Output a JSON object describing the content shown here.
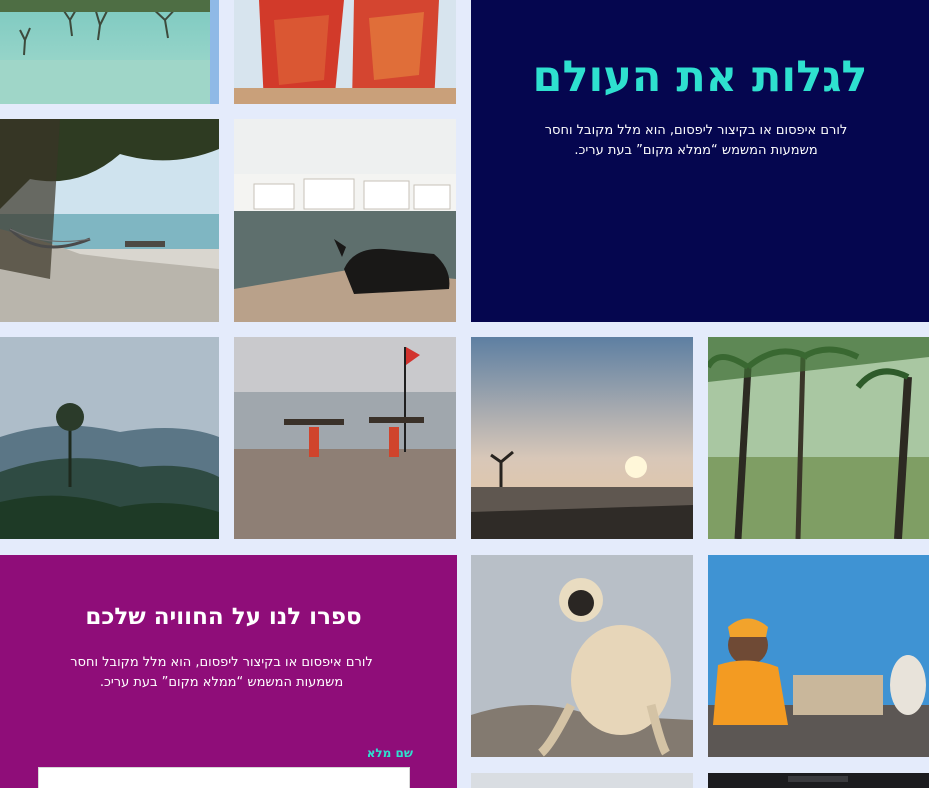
{
  "hero": {
    "title": "לגלות את העולם",
    "text": "לורם איפסום או בקיצור ליפסום, הוא מלל מקובל וחסר משמעות המשמש “ממלא מקום” בעת עריכ."
  },
  "contact": {
    "title": "ספרו לנו על החוויה שלכם",
    "text": "לורם איפסום או בקיצור ליפסום, הוא מלל מקובל וחסר משמעות המשמש “ממלא מקום” בעת עריכ.",
    "name_label": "שם מלא",
    "name_value": ""
  },
  "gallery": {
    "photos": [
      {
        "id": "mangrove-lagoon",
        "icon": "mangrove-photo"
      },
      {
        "id": "women-in-saris",
        "icon": "saris-photo"
      },
      {
        "id": "hammock-beach",
        "icon": "hammock-photo"
      },
      {
        "id": "cow-by-lake",
        "icon": "cow-photo"
      },
      {
        "id": "misty-hills",
        "icon": "hills-photo"
      },
      {
        "id": "beach-carriers",
        "icon": "beach-photo"
      },
      {
        "id": "sunset-shore",
        "icon": "sunset-photo"
      },
      {
        "id": "palm-grove",
        "icon": "palm-photo"
      },
      {
        "id": "langur-monkey",
        "icon": "monkey-photo"
      },
      {
        "id": "sadhu-blue-wall",
        "icon": "sadhu-photo"
      }
    ]
  }
}
